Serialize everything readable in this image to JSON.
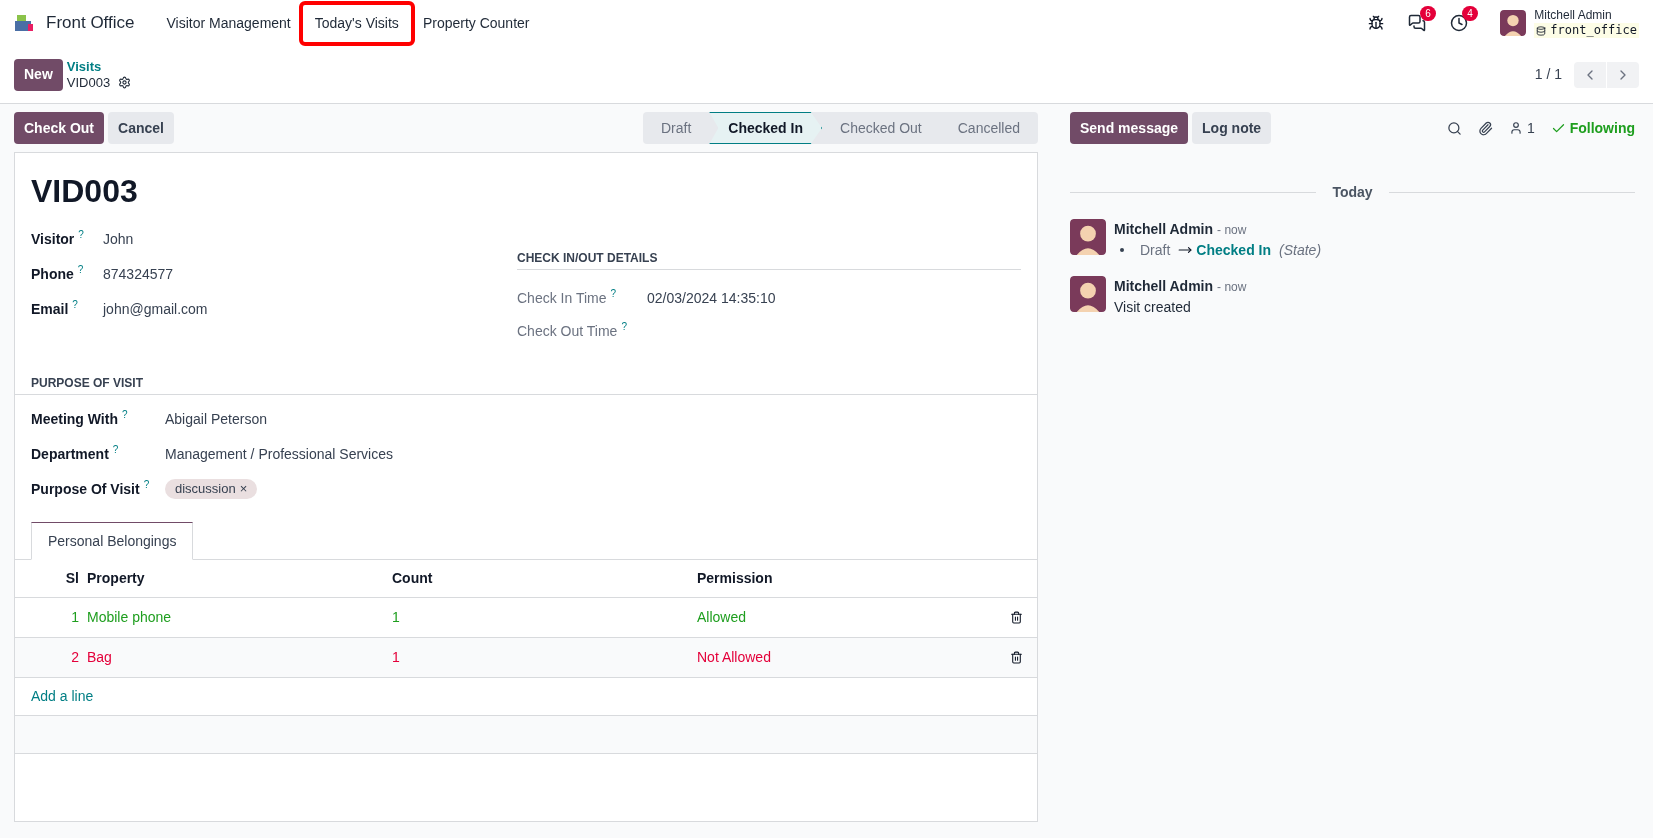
{
  "navbar": {
    "app_name": "Front Office",
    "menu": [
      {
        "label": "Visitor Management",
        "highlighted": false
      },
      {
        "label": "Today's Visits",
        "highlighted": true
      },
      {
        "label": "Property Counter",
        "highlighted": false
      }
    ],
    "messages_badge": "6",
    "activities_badge": "4",
    "user": {
      "name": "Mitchell Admin",
      "database": "front_office"
    }
  },
  "control_panel": {
    "new_button": "New",
    "breadcrumb": "Visits",
    "record": "VID003",
    "pager": "1 / 1"
  },
  "actions": [
    "Check Out",
    "Cancel"
  ],
  "stages": [
    {
      "label": "Draft",
      "selected": false
    },
    {
      "label": "Checked In",
      "selected": true
    },
    {
      "label": "Checked Out",
      "selected": false
    },
    {
      "label": "Cancelled",
      "selected": false
    }
  ],
  "form": {
    "title": "VID003",
    "visitor_fields": [
      {
        "label": "Visitor",
        "help": "?",
        "value": "John"
      },
      {
        "label": "Phone",
        "help": "?",
        "value": "874324577"
      },
      {
        "label": "Email",
        "help": "?",
        "value": "john@gmail.com"
      }
    ],
    "check_section": {
      "heading": "CHECK IN/OUT DETAILS",
      "fields": [
        {
          "label": "Check In Time",
          "help": "?",
          "value": "02/03/2024 14:35:10"
        },
        {
          "label": "Check Out Time",
          "help": "?"
        }
      ]
    },
    "purpose_section": {
      "heading": "PURPOSE OF VISIT",
      "fields": [
        {
          "label": "Meeting With",
          "help": "?",
          "value": "Abigail Peterson"
        },
        {
          "label": "Department",
          "help": "?",
          "value": "Management / Professional Services"
        }
      ],
      "tags_label": "Purpose Of Visit",
      "tags_help": "?",
      "tags": [
        {
          "label": "discussion",
          "remove": "×"
        }
      ]
    },
    "tabs": [
      {
        "label": "Personal Belongings",
        "selected": true
      }
    ],
    "table": {
      "columns": [
        "Sl",
        "Property",
        "Count",
        "Permission"
      ],
      "rows": [
        {
          "sl": "1",
          "property": "Mobile phone",
          "count": "1",
          "permission": "Allowed",
          "color": "#1e9e1e"
        },
        {
          "sl": "2",
          "property": "Bag",
          "count": "1",
          "permission": "Not Allowed",
          "color": "#e4003a"
        }
      ],
      "add_line": "Add a line"
    }
  },
  "chatter": {
    "buttons": [
      "Send message",
      "Log note"
    ],
    "followers": "1",
    "following": "Following",
    "date_separator": "Today",
    "messages": [
      {
        "kind": "tracking",
        "author": "Mitchell Admin",
        "time": "- now",
        "old": "Draft",
        "new": "Checked In",
        "field": "(State)"
      },
      {
        "kind": "text",
        "author": "Mitchell Admin",
        "time": "- now",
        "body": "Visit created"
      }
    ]
  }
}
